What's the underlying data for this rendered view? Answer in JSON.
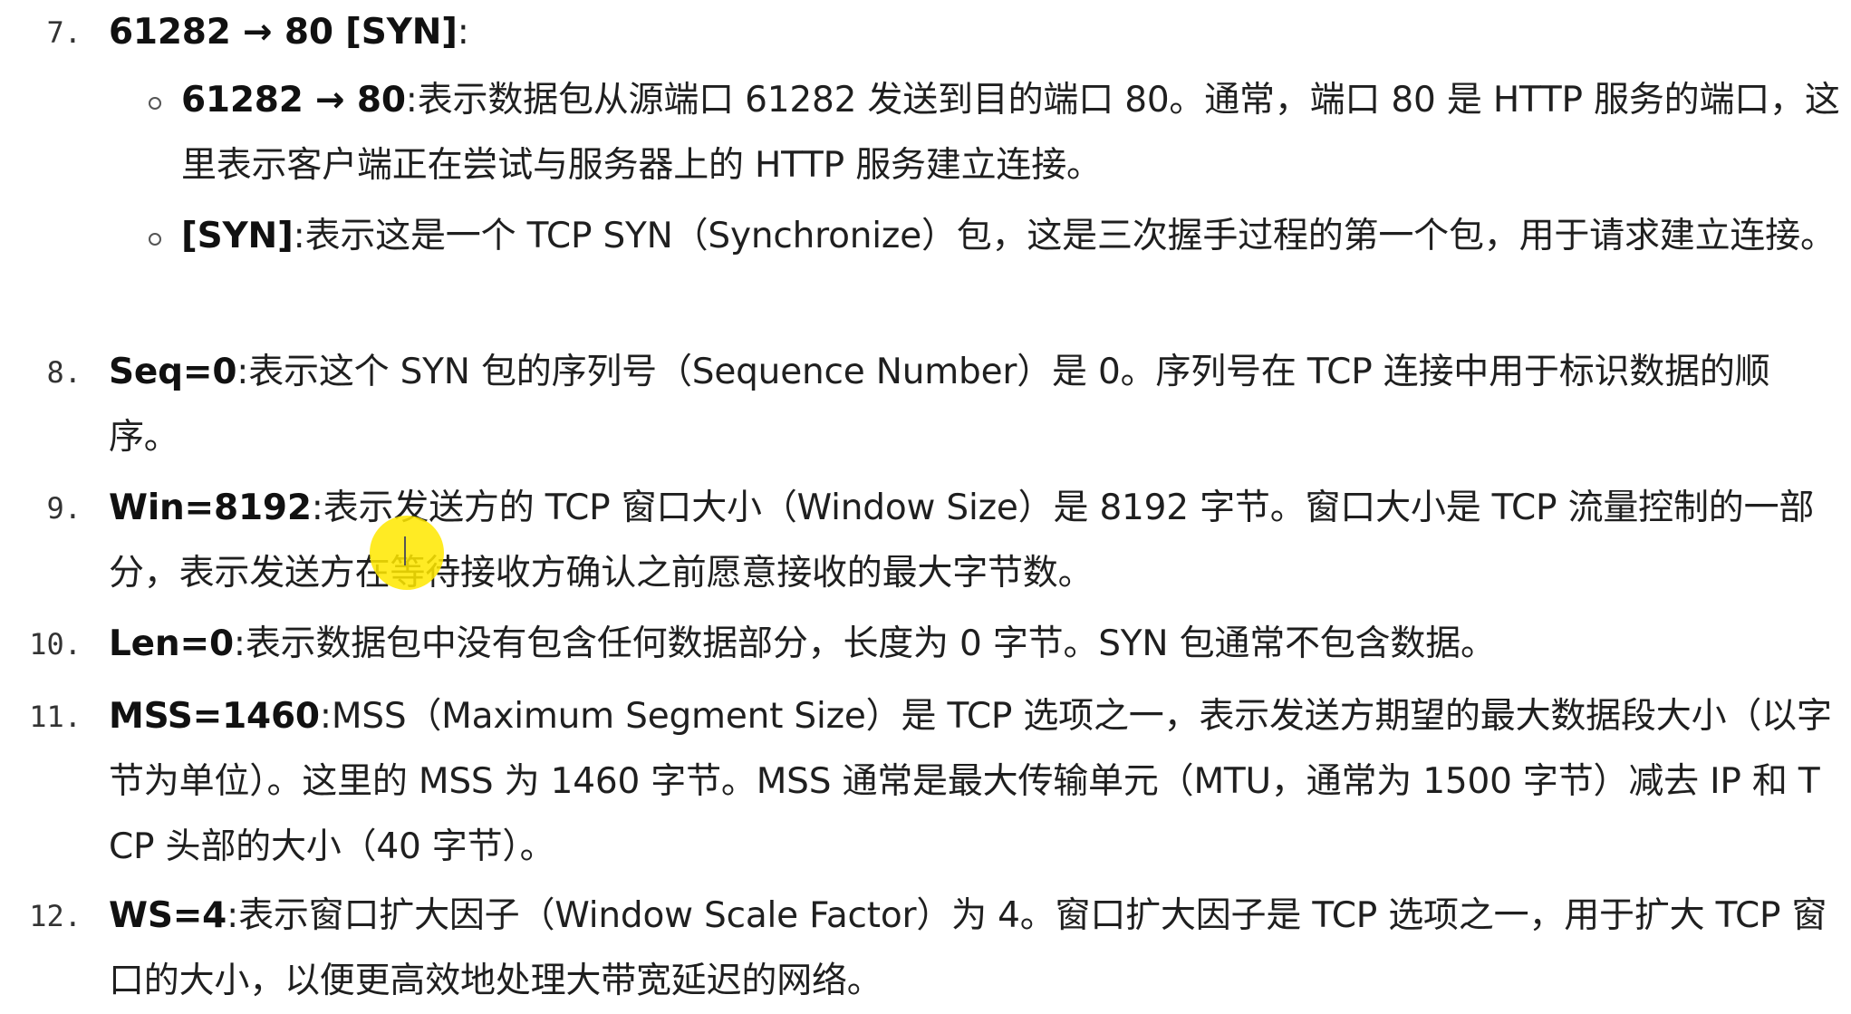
{
  "items": [
    {
      "number": "7.",
      "term": "61282 → 80 [SYN]",
      "separator": ":",
      "text": "",
      "subitems": [
        {
          "term": "61282 → 80",
          "separator": ":",
          "text": "表示数据包从源端口 61282 发送到目的端口 80。通常，端口 80 是 HTTP 服务的端口，这里表示客户端正在尝试与服务器上的 HTTP 服务建立连接。"
        },
        {
          "term": "[SYN]",
          "separator": ":",
          "text": "表示这是一个 TCP SYN（Synchronize）包，这是三次握手过程的第一个包，用于请求建立连接。"
        }
      ]
    },
    {
      "number": "8.",
      "term": "Seq=0",
      "separator": ":",
      "text": "表示这个 SYN 包的序列号（Sequence Number）是 0。序列号在 TCP 连接中用于标识数据的顺序。"
    },
    {
      "number": "9.",
      "term": "Win=8192",
      "separator": ":",
      "text": "表示发送方的 TCP 窗口大小（Window Size）是 8192 字节。窗口大小是 TCP 流量控制的一部分，表示发送方在等待接收方确认之前愿意接收的最大字节数。"
    },
    {
      "number": "10.",
      "term": "Len=0",
      "separator": ":",
      "text": "表示数据包中没有包含任何数据部分，长度为 0 字节。SYN 包通常不包含数据。"
    },
    {
      "number": "11.",
      "term": "MSS=1460",
      "separator": ":",
      "text": "MSS（Maximum Segment Size）是 TCP 选项之一，表示发送方期望的最大数据段大小（以字节为单位）。这里的 MSS 为 1460 字节。MSS 通常是最大传输单元（MTU，通常为 1500 字节）减去 IP 和 TCP 头部的大小（40 字节）。"
    },
    {
      "number": "12.",
      "term": "WS=4",
      "separator": ":",
      "text": "表示窗口扩大因子（Window Scale Factor）为 4。窗口扩大因子是 TCP 选项之一，用于扩大 TCP 窗口的大小，以便更高效地处理大带宽延迟的网络。"
    }
  ],
  "colors": {
    "text": "#1f1f1f",
    "highlight": "#ffe800"
  }
}
